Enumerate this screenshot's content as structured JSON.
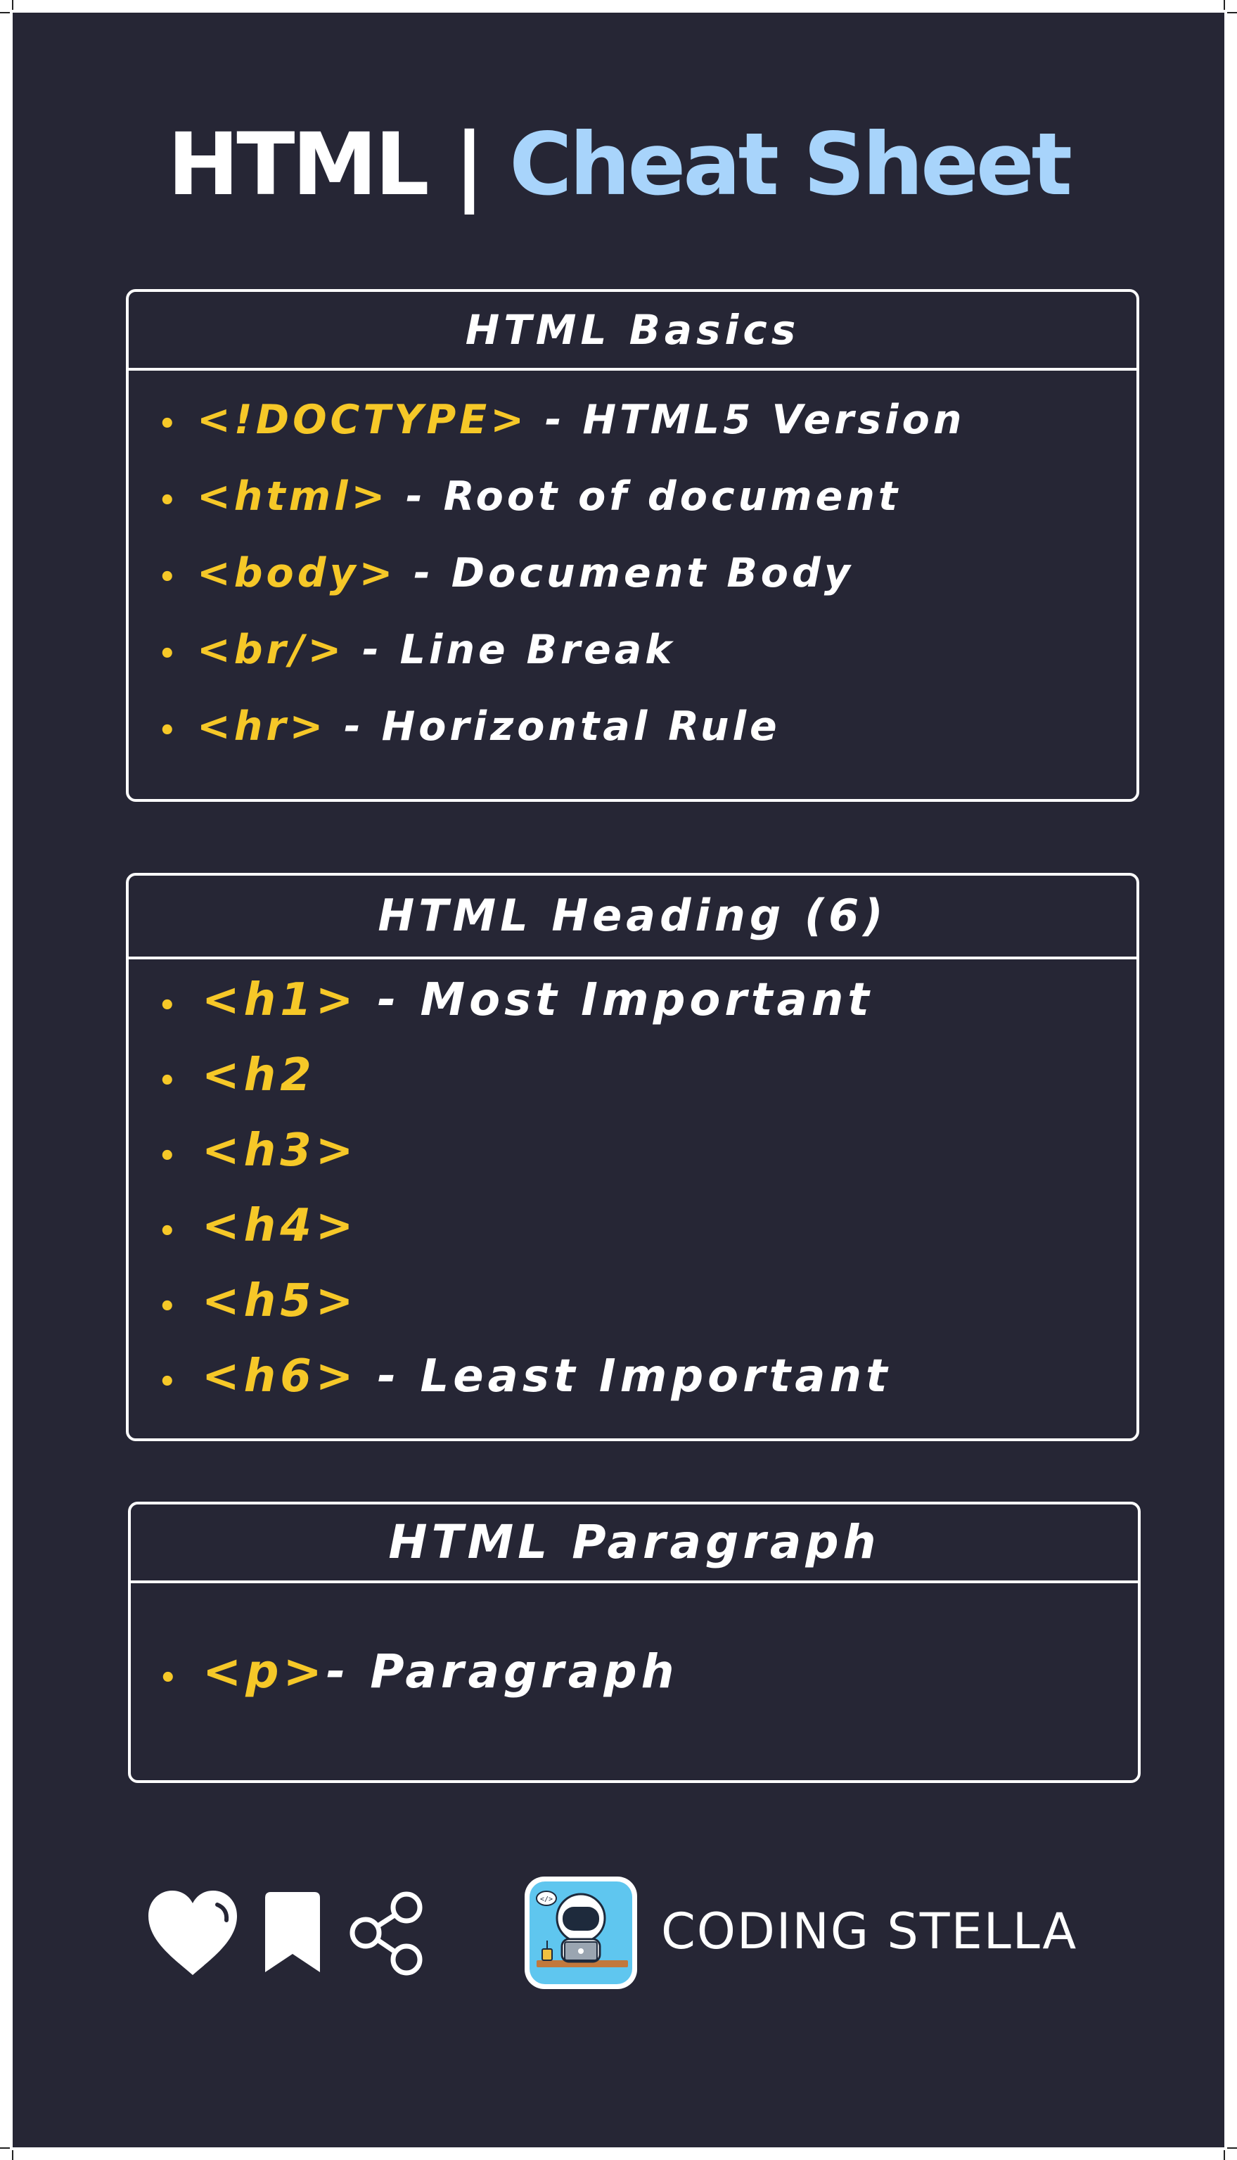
{
  "title": {
    "part1": "HTML",
    "separator": "|",
    "part2": "Cheat Sheet"
  },
  "sections": [
    {
      "heading": "HTML Basics",
      "items": [
        {
          "tag": "<!DOCTYPE>",
          "desc": " - HTML5 Version"
        },
        {
          "tag": "<html>",
          "desc": " - Root of document"
        },
        {
          "tag": "<body>",
          "desc": " - Document Body"
        },
        {
          "tag": "<br/>",
          "desc": " - Line Break"
        },
        {
          "tag": "<hr>",
          "desc": " - Horizontal Rule"
        }
      ]
    },
    {
      "heading": "HTML Heading (6)",
      "items": [
        {
          "tag": "<h1>",
          "desc": " - Most Important"
        },
        {
          "tag": "<h2",
          "desc": ""
        },
        {
          "tag": "<h3>",
          "desc": ""
        },
        {
          "tag": "<h4>",
          "desc": ""
        },
        {
          "tag": "<h5>",
          "desc": ""
        },
        {
          "tag": "<h6>",
          "desc": " - Least Important"
        }
      ]
    },
    {
      "heading": "HTML Paragraph",
      "items": [
        {
          "tag": "<p>",
          "desc": "- Paragraph"
        }
      ]
    }
  ],
  "bullet": "•",
  "footer": {
    "icons": [
      "heart-icon",
      "bookmark-icon",
      "share-icon"
    ],
    "brand": "CODING STELLA"
  },
  "colors": {
    "background": "#262635",
    "accent_blue": "#a8d4fb",
    "tag_yellow": "#f6c828",
    "text": "#ffffff"
  }
}
